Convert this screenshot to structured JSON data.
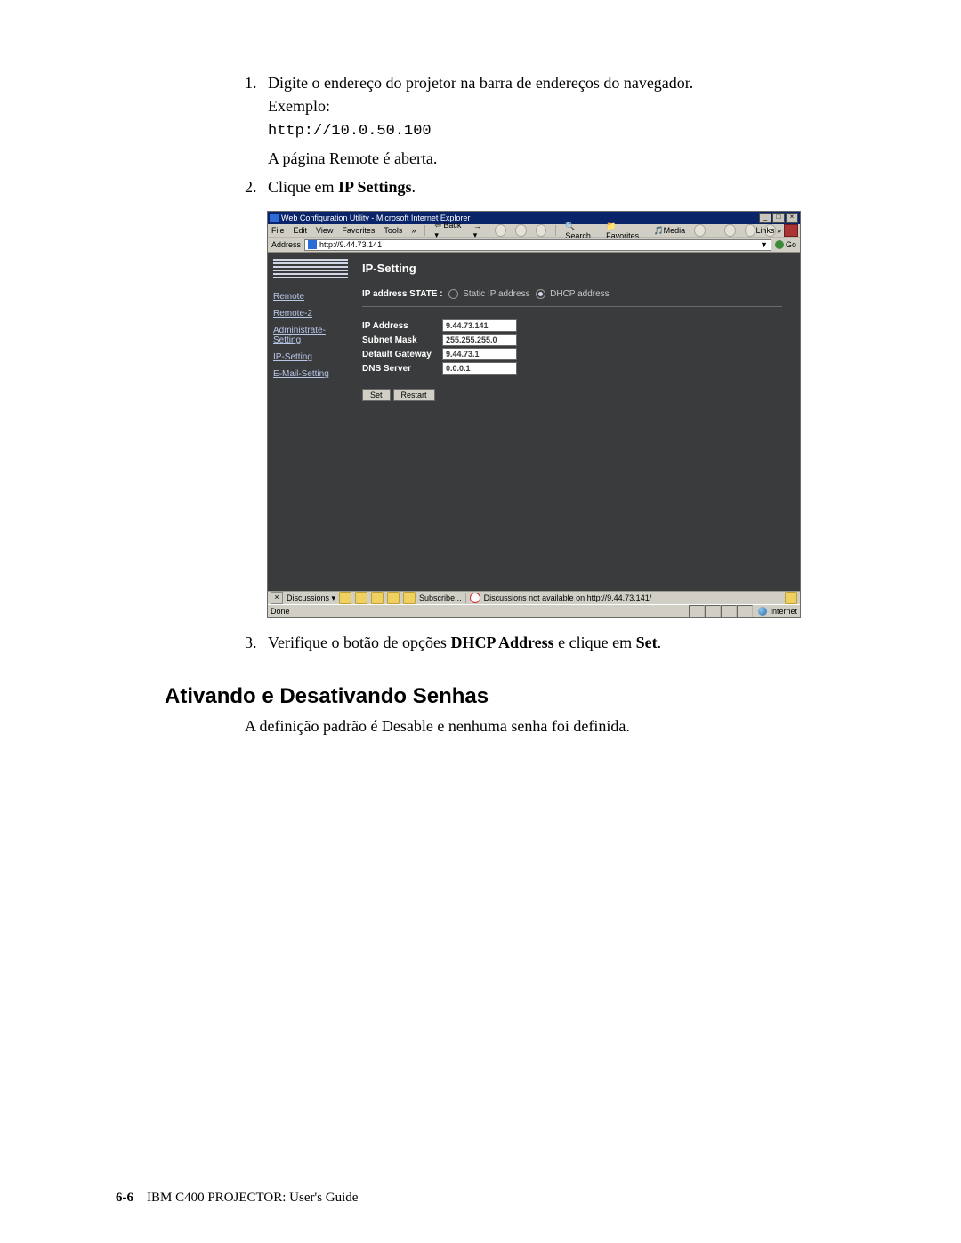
{
  "step1": {
    "num": "1.",
    "text": "Digite o endereço do projetor na barra de endereços do navegador. Exemplo:",
    "mono": "http://10.0.50.100",
    "after": "A página Remote é aberta."
  },
  "step2": {
    "num": "2.",
    "prefix": "Clique em ",
    "bold": "IP Settings",
    "suffix": "."
  },
  "step3": {
    "num": "3.",
    "prefix": "Verifique o botão de opções ",
    "bold1": "DHCP Address",
    "mid": " e clique em ",
    "bold2": "Set",
    "suffix": "."
  },
  "section": {
    "heading": "Ativando e Desativando Senhas",
    "para": "A definição padrão é Desable e nenhuma senha foi definida."
  },
  "footer": {
    "page": "6-6",
    "title": "IBM C400 PROJECTOR: User's Guide"
  },
  "screenshot": {
    "title": "Web Configuration Utility - Microsoft Internet Explorer",
    "menus": [
      "File",
      "Edit",
      "View",
      "Favorites",
      "Tools"
    ],
    "toolbar": {
      "back": "Back",
      "search": "Search",
      "favorites": "Favorites",
      "media": "Media"
    },
    "links_label": "Links",
    "address_label": "Address",
    "address_value": "http://9.44.73.141",
    "go": "Go",
    "nav": {
      "remote": "Remote",
      "remote2": "Remote-2",
      "admin": "Administrate-Setting",
      "ip": "IP-Setting",
      "email": "E-Mail-Setting"
    },
    "main": {
      "heading": "IP-Setting",
      "state_label": "IP address STATE :",
      "opt_static": "Static IP address",
      "opt_dhcp": "DHCP address",
      "fields": {
        "ip_label": "IP Address",
        "ip_value": "9.44.73.141",
        "mask_label": "Subnet Mask",
        "mask_value": "255.255.255.0",
        "gw_label": "Default Gateway",
        "gw_value": "9.44.73.1",
        "dns_label": "DNS Server",
        "dns_value": "0.0.0.1"
      },
      "buttons": {
        "set": "Set",
        "restart": "Restart"
      }
    },
    "discbar": {
      "label": "Discussions",
      "subscribe": "Subscribe...",
      "msg": "Discussions not available on http://9.44.73.141/"
    },
    "status": {
      "done": "Done",
      "zone": "Internet"
    }
  }
}
